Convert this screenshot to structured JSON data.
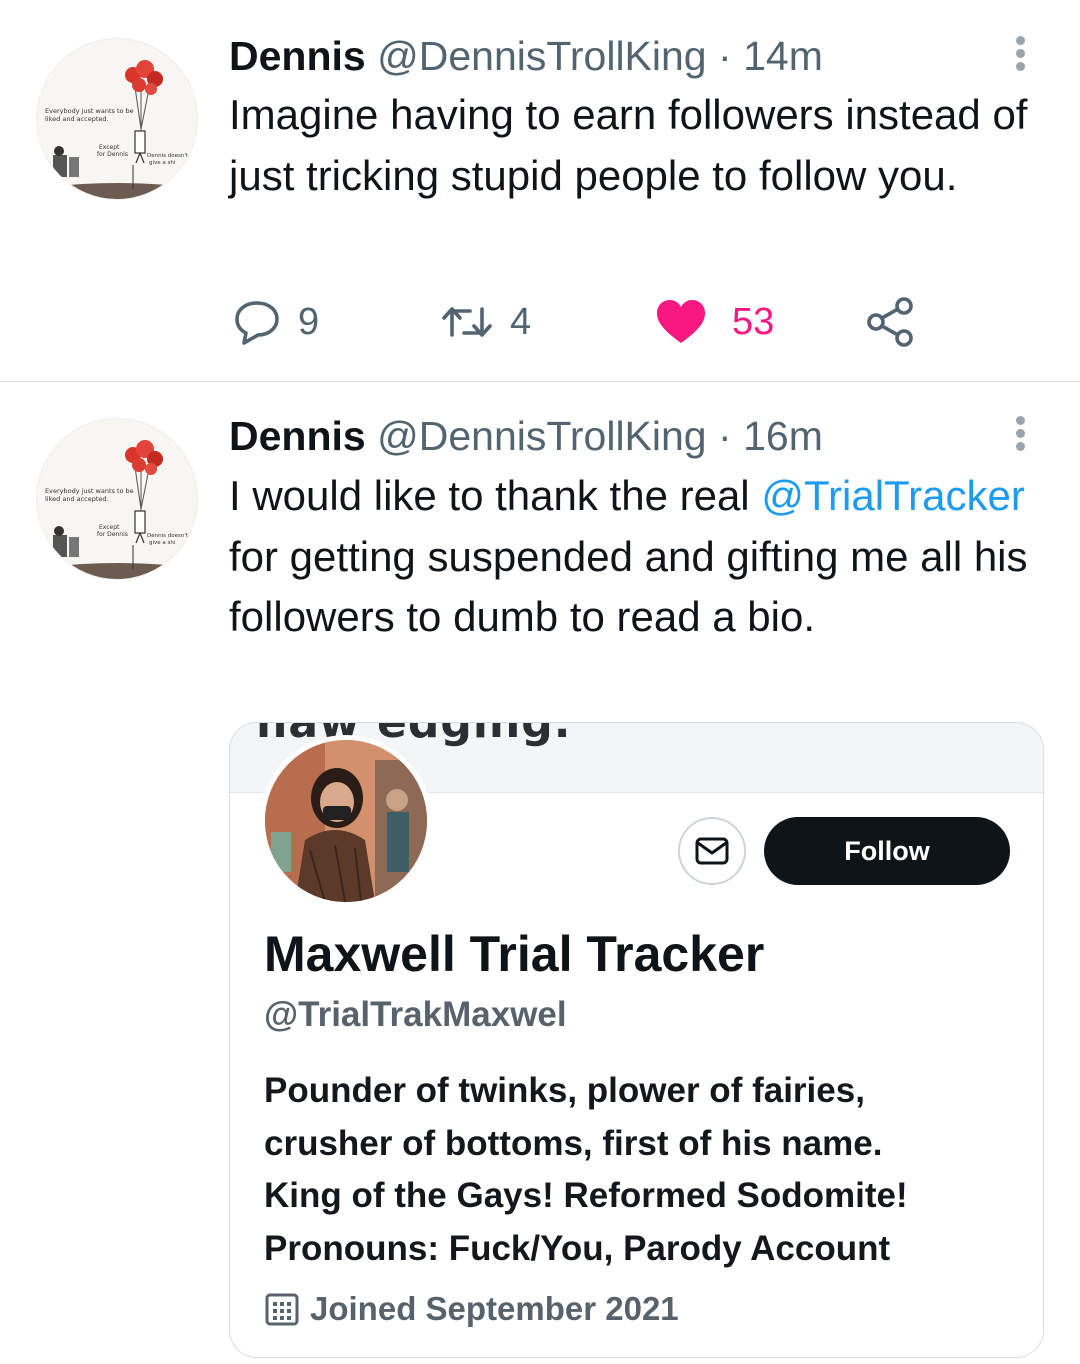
{
  "tweets": [
    {
      "author_name": "Dennis",
      "author_handle": "@DennisTrollKing",
      "separator": "·",
      "time": "14m",
      "avatar_text": [
        "Everybody just wants to be",
        "liked and accepted.",
        "Except",
        "for Dennis",
        "Dennis doesn't",
        "give a shi"
      ],
      "text": "Imagine having to earn followers instead of just tricking stupid people to follow you.",
      "replies": "9",
      "retweets": "4",
      "likes": "53",
      "liked": true
    },
    {
      "author_name": "Dennis",
      "author_handle": "@DennisTrollKing",
      "separator": "·",
      "time": "16m",
      "avatar_text": [
        "Everybody just wants to be",
        "liked and accepted.",
        "Except",
        "for Dennis",
        "Dennis doesn't",
        "give a shi"
      ],
      "text_before": "I would like to thank the real ",
      "mention": "@TrialTracker",
      "text_after": " for getting suspended and gifting me all his followers to dumb to read a bio."
    }
  ],
  "embedded_profile": {
    "banner_text": "naw edging.",
    "follow_label": "Follow",
    "name": "Maxwell Trial Tracker",
    "handle": "@TrialTrakMaxwel",
    "bio_lines": [
      "Pounder of twinks, plower of fairies,",
      "crusher of bottoms, first of his name.",
      "King of the Gays! Reformed Sodomite!",
      "Pronouns: Fuck/You, Parody Account"
    ],
    "joined": "Joined September 2021"
  },
  "colors": {
    "text": "#0f1419",
    "secondary": "#536471",
    "link": "#1d9bf0",
    "like": "#f91880",
    "follow_bg": "#0f1419"
  },
  "icons": [
    "reply-icon",
    "retweet-icon",
    "heart-icon",
    "share-icon",
    "more-icon",
    "mail-icon",
    "calendar-icon"
  ]
}
